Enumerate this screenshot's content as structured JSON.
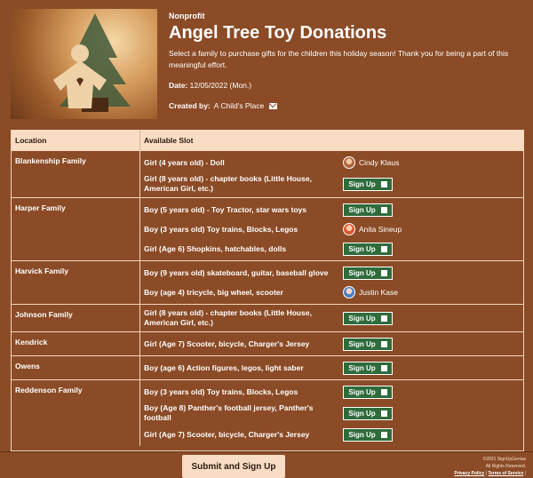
{
  "header": {
    "org_type": "Nonprofit",
    "title": "Angel Tree Toy Donations",
    "description": "Select a family to purchase gifts for the children this holiday season! Thank you for being a part of this meaningful effort.",
    "date_label": "Date:",
    "date_value": "12/05/2022 (Mon.)",
    "created_label": "Created by:",
    "created_value": "A Child's Place"
  },
  "table": {
    "col_location": "Location",
    "col_slot": "Available Slot",
    "signup_label": "Sign Up",
    "groups": [
      {
        "name": "Blankenship Family",
        "slots": [
          {
            "text": "Girl (4 years old) - Doll",
            "taken_by": "Cindy Klaus"
          },
          {
            "text": "Girl (8 years old) - chapter books (Little House, American Girl, etc.)",
            "taken_by": null
          }
        ]
      },
      {
        "name": "Harper Family",
        "slots": [
          {
            "text": "Boy (5 years old) - Toy Tractor, star wars toys",
            "taken_by": null
          },
          {
            "text": "Boy (3 years old) Toy trains, Blocks, Legos",
            "taken_by": "Anita Sineup"
          },
          {
            "text": "Girl (Age 6) Shopkins, hatchables, dolls",
            "taken_by": null
          }
        ]
      },
      {
        "name": "Harvick Family",
        "slots": [
          {
            "text": "Boy (9 years old) skateboard, guitar, baseball glove",
            "taken_by": null
          },
          {
            "text": "Boy (age 4) tricycle, big wheel, scooter",
            "taken_by": "Justin Kase"
          }
        ]
      },
      {
        "name": "Johnson Family",
        "slots": [
          {
            "text": "Girl (8 years old) - chapter books (Little House, American Girl, etc.)",
            "taken_by": null
          }
        ]
      },
      {
        "name": "Kendrick",
        "slots": [
          {
            "text": "Girl (Age 7) Scooter, bicycle, Charger's Jersey",
            "taken_by": null
          }
        ]
      },
      {
        "name": "Owens",
        "slots": [
          {
            "text": "Boy (age 6) Action figures, legos, light saber",
            "taken_by": null
          }
        ]
      },
      {
        "name": "Reddenson Family",
        "slots": [
          {
            "text": "Boy (3 years old) Toy trains, Blocks, Legos",
            "taken_by": null
          },
          {
            "text": "Boy (Age 8) Panther's football jersey, Panther's football",
            "taken_by": null
          },
          {
            "text": "Girl (Age 7) Scooter, bicycle, Charger's Jersey",
            "taken_by": null
          }
        ]
      }
    ]
  },
  "footer": {
    "submit_label": "Submit and Sign Up",
    "copyright": "©2021 SignUpGenius",
    "rights": "All Rights Reserved.",
    "privacy": "Privacy Policy",
    "terms": "Terms of Service"
  },
  "colors": {
    "background": "#8b4b26",
    "header_row": "#f8dcc4",
    "button": "#2f6b3b"
  }
}
